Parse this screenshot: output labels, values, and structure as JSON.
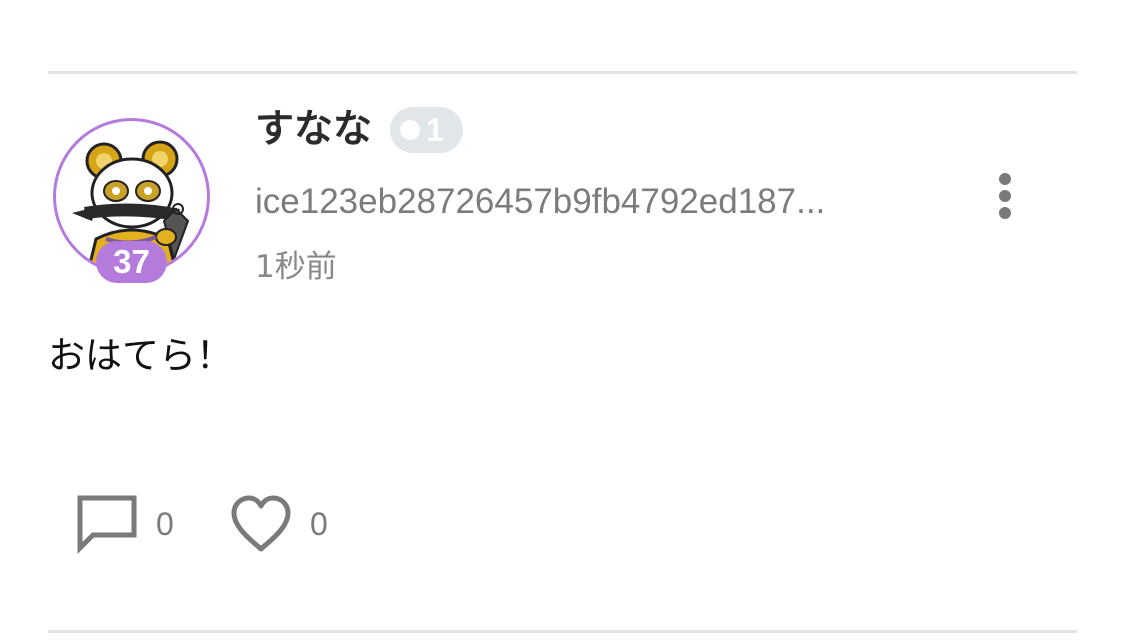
{
  "post": {
    "author": {
      "name": "すなな",
      "level": "37",
      "badge_count": "1",
      "id": "ice123eb28726457b9fb4792ed187...",
      "avatar_icon": "panda-ninja-avatar"
    },
    "timestamp": "1秒前",
    "body": "おはてら！",
    "actions": {
      "comments": {
        "icon": "comment-icon",
        "count": "0"
      },
      "likes": {
        "icon": "heart-icon",
        "count": "0"
      },
      "more": {
        "icon": "more-vertical-icon"
      }
    }
  },
  "colors": {
    "avatar_ring": "#b57bdc",
    "level_badge": "#b57bdc",
    "count_badge": "#e1e6ea",
    "secondary_text": "#7c7c7c",
    "icon_gray": "#7a7a7a",
    "divider": "#e3e3e3"
  }
}
